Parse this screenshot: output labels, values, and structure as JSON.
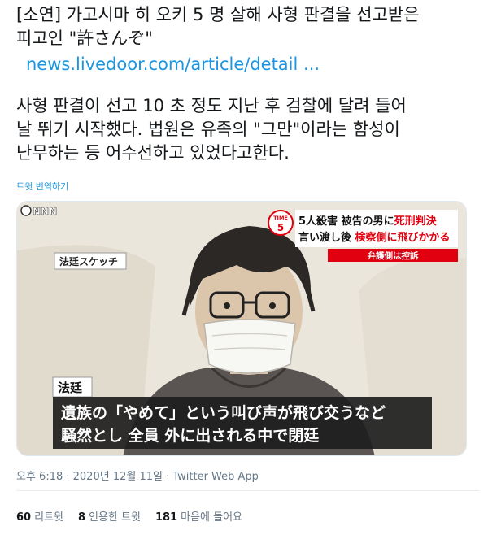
{
  "tweet": {
    "line1": "[소연] 가고시마 히 오키 5 명 살해 사형 판결을 선고받은",
    "line2": "피고인 \"許さんぞ\"",
    "link": "news.livedoor.com/article/detail ...",
    "para2_line1": "사형 판결이 선고 10 초 정도 지난 후 검찰에 달려 들어",
    "para2_line2": "날 뛰기 시작했다. 법원은 유족의 \"그만\"이라는 함성이",
    "para2_line3": "난무하는 등 어수선하고 있었다고한다.",
    "translate": "트윗 번역하기"
  },
  "media": {
    "network": "NNN",
    "sketch_label": "法廷スケッチ",
    "time_badge_top": "TIME",
    "time_badge_num": "5",
    "headline_1_pre": "5人殺害 被告の男に",
    "headline_1_red": "死刑判決",
    "headline_2_pre": "言い渡し後 ",
    "headline_2_red": "検察側に飛びかかる",
    "headline_3": "弁護側は控訴",
    "location_label": "法廷",
    "caption_1": "遺族の「やめて」という叫び声が飛び交うなど",
    "caption_2": "騒然とし 全員 外に出される中で閉廷",
    "colors": {
      "red": "#e1000f",
      "caption_bg": "#1e1e1e"
    }
  },
  "meta": {
    "time": "오후 6:18 · 2020년 12월 11일 · Twitter Web App"
  },
  "stats": {
    "retweets_count": "60",
    "retweets_label": "리트윗",
    "quotes_count": "8",
    "quotes_label": "인용한 트윗",
    "likes_count": "181",
    "likes_label": "마음에 들어요"
  }
}
